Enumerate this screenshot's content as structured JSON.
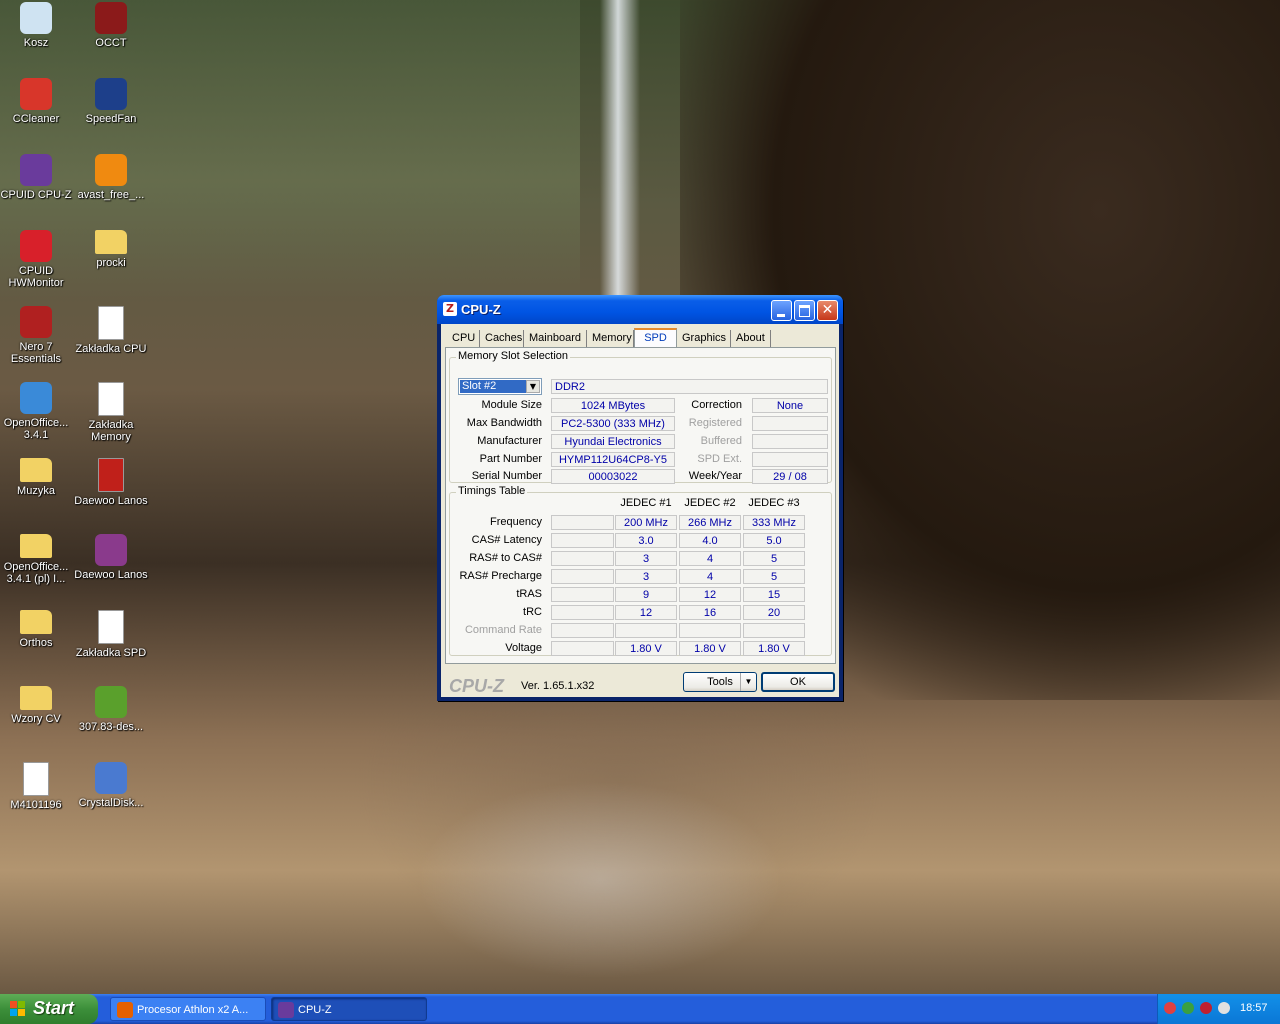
{
  "desktop": {
    "icons": [
      {
        "label": "Kosz",
        "icon": "recycle-bin-icon",
        "color": "#cfe3f2"
      },
      {
        "label": "OCCT",
        "icon": "occt-icon",
        "color": "#8b1a1a"
      },
      {
        "label": "CCleaner",
        "icon": "ccleaner-icon",
        "color": "#d8362a"
      },
      {
        "label": "SpeedFan",
        "icon": "speedfan-icon",
        "color": "#1d3f8a"
      },
      {
        "label": "CPUID CPU-Z",
        "icon": "cpuz-icon",
        "color": "#6a3b9c"
      },
      {
        "label": "avast_free_...",
        "icon": "avast-icon",
        "color": "#f08a10"
      },
      {
        "label": "CPUID HWMonitor",
        "icon": "hwmonitor-icon",
        "color": "#d8202a"
      },
      {
        "label": "procki",
        "icon": "folder-icon",
        "color": "#f2d264"
      },
      {
        "label": "Nero 7 Essentials",
        "icon": "nero-icon",
        "color": "#b02020"
      },
      {
        "label": "Zakładka CPU",
        "icon": "document-icon",
        "color": "#ffffff"
      },
      {
        "label": "OpenOffice... 3.4.1",
        "icon": "openoffice-icon",
        "color": "#3a8ad8"
      },
      {
        "label": "Zakładka Memory",
        "icon": "document-icon",
        "color": "#ffffff"
      },
      {
        "label": "Muzyka",
        "icon": "folder-icon",
        "color": "#f2d264"
      },
      {
        "label": "Daewoo Lanos",
        "icon": "pdf-icon",
        "color": "#c0201a"
      },
      {
        "label": "OpenOffice... 3.4.1 (pl) I...",
        "icon": "folder-icon",
        "color": "#f2d264"
      },
      {
        "label": "Daewoo Lanos",
        "icon": "winrar-icon",
        "color": "#8a3a8c"
      },
      {
        "label": "Orthos",
        "icon": "folder-icon",
        "color": "#f2d264"
      },
      {
        "label": "Zakładka SPD",
        "icon": "document-icon",
        "color": "#ffffff"
      },
      {
        "label": "Wzory CV",
        "icon": "folder-icon",
        "color": "#f2d264"
      },
      {
        "label": "307.83-des...",
        "icon": "nvidia-icon",
        "color": "#5aa02c"
      },
      {
        "label": "M4101196",
        "icon": "document-icon",
        "color": "#ffffff"
      },
      {
        "label": "CrystalDisk...",
        "icon": "crystaldisk-icon",
        "color": "#4a7ad0"
      }
    ]
  },
  "window": {
    "title": "CPU-Z",
    "app_icon": "Z",
    "close_glyph": "✕",
    "tabs": [
      "CPU",
      "Caches",
      "Mainboard",
      "Memory",
      "SPD",
      "Graphics",
      "About"
    ],
    "active_tab": "SPD",
    "slot_group": {
      "title": "Memory Slot Selection",
      "slot_value": "Slot #2",
      "memory_type": "DDR2",
      "module_size_label": "Module Size",
      "module_size": "1024 MBytes",
      "max_bandwidth_label": "Max Bandwidth",
      "max_bandwidth": "PC2-5300 (333 MHz)",
      "manufacturer_label": "Manufacturer",
      "manufacturer": "Hyundai Electronics",
      "part_number_label": "Part Number",
      "part_number": "HYMP112U64CP8-Y5",
      "serial_number_label": "Serial Number",
      "serial_number": "00003022",
      "correction_label": "Correction",
      "correction": "None",
      "registered_label": "Registered",
      "registered": "",
      "buffered_label": "Buffered",
      "buffered": "",
      "spd_ext_label": "SPD Ext.",
      "spd_ext": "",
      "week_year_label": "Week/Year",
      "week_year": "29 / 08"
    },
    "timings": {
      "title": "Timings Table",
      "columns": [
        "JEDEC #1",
        "JEDEC #2",
        "JEDEC #3"
      ],
      "rows": [
        {
          "label": "Frequency",
          "dim": false,
          "values": [
            "200 MHz",
            "266 MHz",
            "333 MHz"
          ]
        },
        {
          "label": "CAS# Latency",
          "dim": false,
          "values": [
            "3.0",
            "4.0",
            "5.0"
          ]
        },
        {
          "label": "RAS# to CAS#",
          "dim": false,
          "values": [
            "3",
            "4",
            "5"
          ]
        },
        {
          "label": "RAS# Precharge",
          "dim": false,
          "values": [
            "3",
            "4",
            "5"
          ]
        },
        {
          "label": "tRAS",
          "dim": false,
          "values": [
            "9",
            "12",
            "15"
          ]
        },
        {
          "label": "tRC",
          "dim": false,
          "values": [
            "12",
            "16",
            "20"
          ]
        },
        {
          "label": "Command Rate",
          "dim": true,
          "values": [
            "",
            "",
            ""
          ]
        },
        {
          "label": "Voltage",
          "dim": false,
          "values": [
            "1.80 V",
            "1.80 V",
            "1.80 V"
          ]
        }
      ]
    },
    "footer": {
      "logo": "CPU-Z",
      "version": "Ver. 1.65.1.x32",
      "tools_label": "Tools",
      "ok_label": "OK"
    }
  },
  "taskbar": {
    "start_label": "Start",
    "tasks": [
      {
        "label": "Procesor Athlon x2 A...",
        "icon": "firefox-icon",
        "color": "#e66000"
      },
      {
        "label": "CPU-Z",
        "icon": "cpuz-icon",
        "color": "#6a3b9c"
      }
    ],
    "clock": "18:57"
  }
}
